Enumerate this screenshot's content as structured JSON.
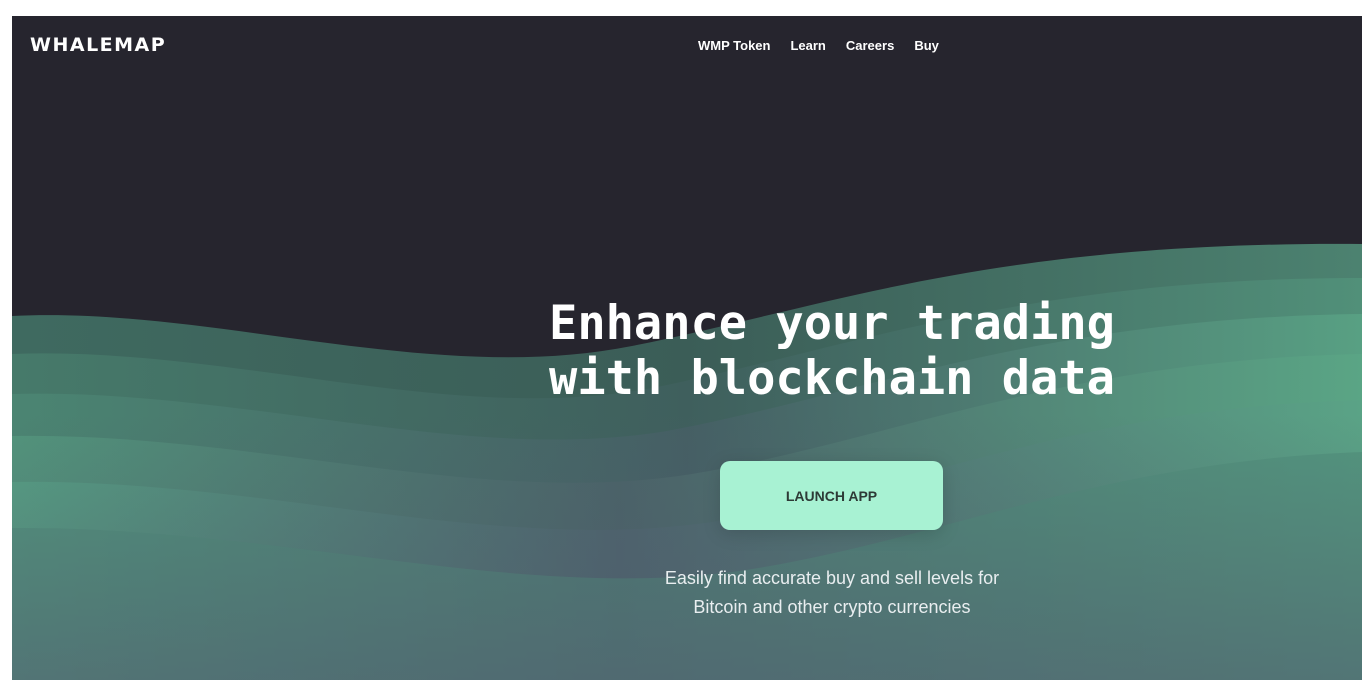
{
  "header": {
    "logo": "WHALEMAP",
    "nav": [
      {
        "label": "WMP Token"
      },
      {
        "label": "Learn"
      },
      {
        "label": "Careers"
      },
      {
        "label": "Buy"
      }
    ]
  },
  "hero": {
    "headline_line1": "Enhance your trading",
    "headline_line2": "with blockchain data",
    "cta_label": "LAUNCH APP",
    "subtext_line1": "Easily find accurate buy and sell levels for",
    "subtext_line2": "Bitcoin and other crypto currencies"
  },
  "colors": {
    "background": "#26252e",
    "accent": "#a8f2d3",
    "wave_green": "#4a9c7e"
  }
}
